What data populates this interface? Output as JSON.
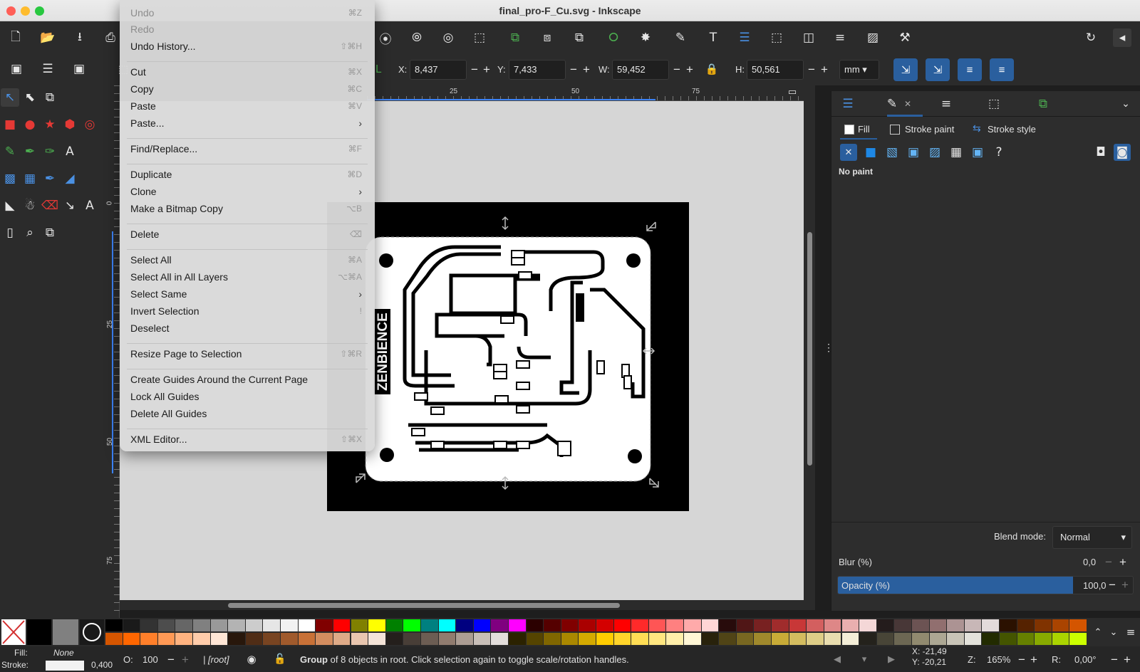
{
  "window": {
    "title": "final_pro-F_Cu.svg - Inkscape"
  },
  "menu": {
    "items": [
      {
        "label": "Undo",
        "shortcut": "⌘Z",
        "disabled": true
      },
      {
        "label": "Redo",
        "shortcut": "",
        "disabled": true
      },
      {
        "label": "Undo History...",
        "shortcut": "⇧⌘H"
      },
      {
        "label": "Cut",
        "shortcut": "⌘X"
      },
      {
        "label": "Copy",
        "shortcut": "⌘C"
      },
      {
        "label": "Paste",
        "shortcut": "⌘V"
      },
      {
        "label": "Paste...",
        "submenu": true
      },
      {
        "label": "Find/Replace...",
        "shortcut": "⌘F"
      },
      {
        "label": "Duplicate",
        "shortcut": "⌘D"
      },
      {
        "label": "Clone",
        "submenu": true
      },
      {
        "label": "Make a Bitmap Copy",
        "shortcut": "⌥B"
      },
      {
        "label": "Delete",
        "shortcut": "⌫"
      },
      {
        "label": "Select All",
        "shortcut": "⌘A"
      },
      {
        "label": "Select All in All Layers",
        "shortcut": "⌥⌘A"
      },
      {
        "label": "Select Same",
        "submenu": true
      },
      {
        "label": "Invert Selection",
        "shortcut": "!"
      },
      {
        "label": "Deselect",
        "shortcut": ""
      },
      {
        "label": "Resize Page to Selection",
        "shortcut": "⇧⌘R"
      },
      {
        "label": "Create Guides Around the Current Page",
        "shortcut": ""
      },
      {
        "label": "Lock All Guides",
        "shortcut": ""
      },
      {
        "label": "Delete All Guides",
        "shortcut": ""
      },
      {
        "label": "XML Editor...",
        "shortcut": "⇧⌘X"
      }
    ]
  },
  "toolbar": {
    "x_label": "X:",
    "x_value": "8,437",
    "y_label": "Y:",
    "y_value": "7,433",
    "w_label": "W:",
    "w_value": "59,452",
    "h_label": "H:",
    "h_value": "50,561",
    "unit": "mm"
  },
  "ruler": {
    "h_ticks": [
      "25",
      "50",
      "75"
    ],
    "v_ticks": [
      "0",
      "25",
      "50",
      "75"
    ]
  },
  "canvas": {
    "board_text": "ZENBIENCE"
  },
  "fill_stroke": {
    "tabs": {
      "fill": "Fill",
      "stroke_paint": "Stroke paint",
      "stroke_style": "Stroke style"
    },
    "paint_status": "No paint",
    "blend_label": "Blend mode:",
    "blend_value": "Normal",
    "blur_label": "Blur (%)",
    "blur_value": "0,0",
    "opacity_label": "Opacity (%)",
    "opacity_value": "100,0",
    "opacity_fraction": 1.0
  },
  "status": {
    "fill_label": "Fill:",
    "fill_value": "None",
    "stroke_label": "Stroke:",
    "stroke_width": "0,400",
    "o_label": "O:",
    "o_value": "100",
    "layer": "[root]",
    "message_bold": "Group",
    "message": " of 8 objects in root. Click selection again to toggle scale/rotation handles.",
    "cursor_x": "X: -21,49",
    "cursor_y": "Y: -20,21",
    "zoom_label": "Z:",
    "zoom_value": "165%",
    "rotation_label": "R:",
    "rotation_value": "0,00°"
  },
  "palette": {
    "row1": [
      "#000000",
      "#1a1a1a",
      "#333333",
      "#4d4d4d",
      "#666666",
      "#808080",
      "#999999",
      "#b3b3b3",
      "#cccccc",
      "#e6e6e6",
      "#f2f2f2",
      "#ffffff",
      "#800000",
      "#ff0000",
      "#808000",
      "#ffff00",
      "#008000",
      "#00ff00",
      "#008080",
      "#00ffff",
      "#000080",
      "#0000ff",
      "#800080",
      "#ff00ff",
      "#2b0000",
      "#550000",
      "#800000",
      "#aa0000",
      "#d40000",
      "#ff0000",
      "#ff2a2a",
      "#ff5555",
      "#ff8080",
      "#ffaaaa",
      "#ffd5d5",
      "#280b0b",
      "#501616",
      "#782121",
      "#a02c2c",
      "#c83737",
      "#d35f5f",
      "#de8787",
      "#e9afaf",
      "#f4d7d7",
      "#241c1c",
      "#483737",
      "#6c5353",
      "#916f6f",
      "#ac9393",
      "#c8b7b7",
      "#e3dbdb",
      "#2b1100",
      "#552200",
      "#803300",
      "#aa4400",
      "#d45500"
    ],
    "row2": [
      "#d45500",
      "#ff6600",
      "#ff7f2a",
      "#ff9955",
      "#ffb380",
      "#ffccaa",
      "#ffe6d5",
      "#28170b",
      "#502d16",
      "#784421",
      "#a05a2c",
      "#c87137",
      "#d38d5f",
      "#deaa87",
      "#e9c6af",
      "#f4e3d7",
      "#241f1c",
      "#483e37",
      "#6c5d53",
      "#917c6f",
      "#ac9d93",
      "#c8beb7",
      "#e3dedb",
      "#2b2200",
      "#554400",
      "#806600",
      "#aa8800",
      "#d4aa00",
      "#ffcc00",
      "#ffd42a",
      "#ffdd55",
      "#ffe680",
      "#ffeeaa",
      "#fff6d5",
      "#28220b",
      "#504416",
      "#786721",
      "#a0892c",
      "#c8ab37",
      "#d3bc5f",
      "#decd87",
      "#e9ddaf",
      "#f4eed7",
      "#24221c",
      "#484537",
      "#6c6753",
      "#918a6f",
      "#aca793",
      "#c8c4b7",
      "#e3e2db",
      "#222b00",
      "#445500",
      "#668000",
      "#88aa00",
      "#aad400",
      "#ccff00"
    ]
  },
  "colors": {
    "accent": "#2a5f9e",
    "panel_bg": "#2d2d2d",
    "menu_bg": "#dadada"
  }
}
